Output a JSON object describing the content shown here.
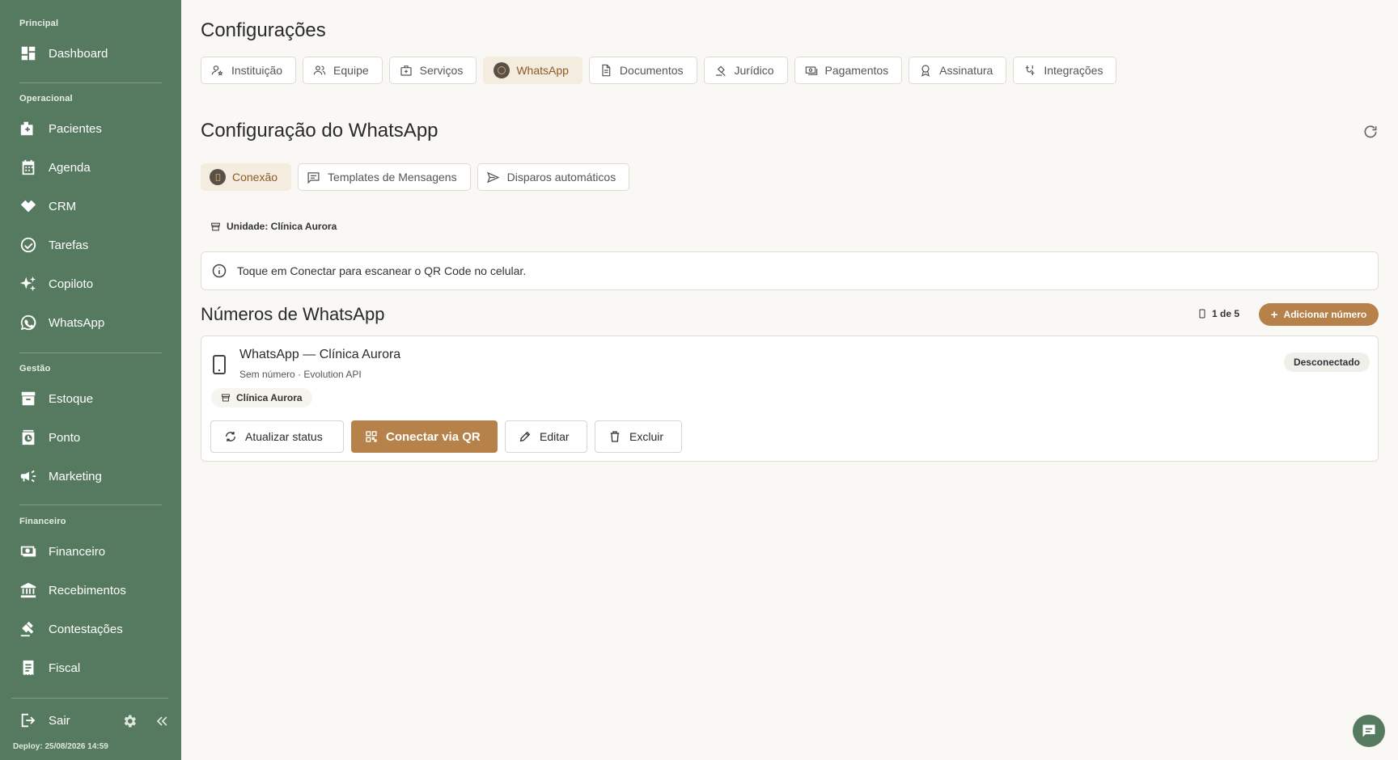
{
  "sidebar": {
    "sections": {
      "principal": "Principal",
      "operacional": "Operacional",
      "gestao": "Gestão",
      "financeiro": "Financeiro"
    },
    "items": {
      "dashboard": "Dashboard",
      "pacientes": "Pacientes",
      "agenda": "Agenda",
      "crm": "CRM",
      "tarefas": "Tarefas",
      "copiloto": "Copiloto",
      "whatsapp": "WhatsApp",
      "estoque": "Estoque",
      "ponto": "Ponto",
      "marketing": "Marketing",
      "financeiro": "Financeiro",
      "recebimentos": "Recebimentos",
      "contestacoes": "Contestações",
      "fiscal": "Fiscal"
    },
    "logout_label": "Sair",
    "deploy_text": "Deploy: 25/08/2026 14:59"
  },
  "page": {
    "title": "Configurações",
    "tabs": {
      "instituicao": "Instituição",
      "equipe": "Equipe",
      "servicos": "Serviços",
      "whatsapp": "WhatsApp",
      "documentos": "Documentos",
      "juridico": "Jurídico",
      "pagamentos": "Pagamentos",
      "assinatura": "Assinatura",
      "integracoes": "Integrações"
    },
    "active_tab": "WhatsApp"
  },
  "whatsapp": {
    "title": "Configuração do WhatsApp",
    "subtabs": {
      "conexao": "Conexão",
      "templates": "Templates de Mensagens",
      "disparos": "Disparos automáticos"
    },
    "active_subtab": "Conexão",
    "unit_label": "Unidade: Clínica Aurora",
    "info_text": "Toque em Conectar para escanear o QR Code no celular.",
    "numbers_title": "Números de WhatsApp",
    "count_text": "1 de 5",
    "add_button": "Adicionar número",
    "card": {
      "title": "WhatsApp — Clínica Aurora",
      "subtitle": "Sem número · Evolution API",
      "status": "Desconectado",
      "unit_chip": "Clínica Aurora",
      "actions": {
        "refresh": "Atualizar status",
        "connect": "Conectar via QR",
        "edit": "Editar",
        "delete": "Excluir"
      }
    }
  },
  "colors": {
    "sidebar_bg": "#567a60",
    "accent": "#b6824a",
    "page_bg": "#f9f8f4",
    "active_tab_bg": "#f5ece0"
  }
}
